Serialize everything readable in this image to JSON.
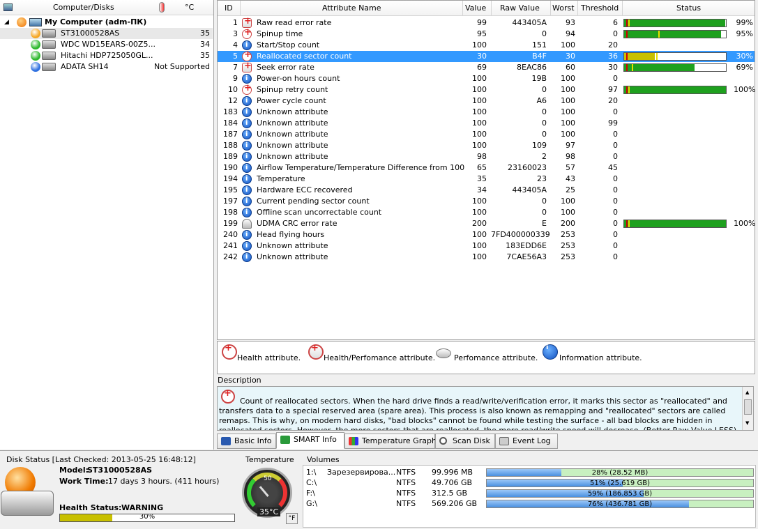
{
  "tree": {
    "header_name": "Computer/Disks",
    "header_temp": "°C",
    "root": "My Computer (adm-ПК)",
    "disks": [
      {
        "name": "ST31000528AS",
        "temp": "35",
        "color": "#f5a623"
      },
      {
        "name": "WDC WD15EARS-00Z5...",
        "temp": "34",
        "color": "#2db82d"
      },
      {
        "name": "Hitachi HDP725050GL...",
        "temp": "35",
        "color": "#2db82d"
      },
      {
        "name": "ADATA SH14",
        "temp": "Not Supported",
        "color": "#2d6fe0"
      }
    ]
  },
  "table": {
    "headers": [
      "ID",
      "Attribute Name",
      "Value",
      "Raw Value",
      "Worst",
      "Threshold",
      "Status"
    ],
    "rows": [
      {
        "id": "1",
        "icon": "health-perf",
        "name": "Raw read error rate",
        "value": "99",
        "raw": "443405A",
        "worst": "93",
        "thr": "6",
        "pct": "99%",
        "level": 0.99
      },
      {
        "id": "3",
        "icon": "health",
        "name": "Spinup time",
        "value": "95",
        "raw": "0",
        "worst": "94",
        "thr": "0",
        "pct": "95%",
        "level": 0.95
      },
      {
        "id": "4",
        "icon": "info",
        "name": "Start/Stop count",
        "value": "100",
        "raw": "151",
        "worst": "100",
        "thr": "20",
        "pct": "",
        "level": 0
      },
      {
        "id": "5",
        "icon": "health",
        "name": "Reallocated sector count",
        "value": "30",
        "raw": "B4F",
        "worst": "30",
        "thr": "36",
        "pct": "30%",
        "level": 0.3
      },
      {
        "id": "7",
        "icon": "health-perf",
        "name": "Seek error rate",
        "value": "69",
        "raw": "8EAC86",
        "worst": "60",
        "thr": "30",
        "pct": "69%",
        "level": 0.69
      },
      {
        "id": "9",
        "icon": "info",
        "name": "Power-on hours count",
        "value": "100",
        "raw": "19B",
        "worst": "100",
        "thr": "0",
        "pct": "",
        "level": 0
      },
      {
        "id": "10",
        "icon": "health",
        "name": "Spinup retry count",
        "value": "100",
        "raw": "0",
        "worst": "100",
        "thr": "97",
        "pct": "100%",
        "level": 1.0
      },
      {
        "id": "12",
        "icon": "info",
        "name": "Power cycle count",
        "value": "100",
        "raw": "A6",
        "worst": "100",
        "thr": "20",
        "pct": "",
        "level": 0
      },
      {
        "id": "183",
        "icon": "info",
        "name": "Unknown attribute",
        "value": "100",
        "raw": "0",
        "worst": "100",
        "thr": "0",
        "pct": "",
        "level": 0
      },
      {
        "id": "184",
        "icon": "info",
        "name": "Unknown attribute",
        "value": "100",
        "raw": "0",
        "worst": "100",
        "thr": "99",
        "pct": "",
        "level": 0
      },
      {
        "id": "187",
        "icon": "info",
        "name": "Unknown attribute",
        "value": "100",
        "raw": "0",
        "worst": "100",
        "thr": "0",
        "pct": "",
        "level": 0
      },
      {
        "id": "188",
        "icon": "info",
        "name": "Unknown attribute",
        "value": "100",
        "raw": "109",
        "worst": "97",
        "thr": "0",
        "pct": "",
        "level": 0
      },
      {
        "id": "189",
        "icon": "info",
        "name": "Unknown attribute",
        "value": "98",
        "raw": "2",
        "worst": "98",
        "thr": "0",
        "pct": "",
        "level": 0
      },
      {
        "id": "190",
        "icon": "info",
        "name": "Airflow Temperature/Temperature Difference from 100",
        "value": "65",
        "raw": "23160023",
        "worst": "57",
        "thr": "45",
        "pct": "",
        "level": 0
      },
      {
        "id": "194",
        "icon": "info",
        "name": "Temperature",
        "value": "35",
        "raw": "23",
        "worst": "43",
        "thr": "0",
        "pct": "",
        "level": 0
      },
      {
        "id": "195",
        "icon": "info",
        "name": "Hardware ECC recovered",
        "value": "34",
        "raw": "443405A",
        "worst": "25",
        "thr": "0",
        "pct": "",
        "level": 0
      },
      {
        "id": "197",
        "icon": "info",
        "name": "Current pending sector count",
        "value": "100",
        "raw": "0",
        "worst": "100",
        "thr": "0",
        "pct": "",
        "level": 0
      },
      {
        "id": "198",
        "icon": "info",
        "name": "Offline scan uncorrectable count",
        "value": "100",
        "raw": "0",
        "worst": "100",
        "thr": "0",
        "pct": "",
        "level": 0
      },
      {
        "id": "199",
        "icon": "perf",
        "name": "UDMA CRC error rate",
        "value": "200",
        "raw": "E",
        "worst": "200",
        "thr": "0",
        "pct": "100%",
        "level": 1.0
      },
      {
        "id": "240",
        "icon": "info",
        "name": "Head flying hours",
        "value": "100",
        "raw": "7FD400000339",
        "worst": "253",
        "thr": "0",
        "pct": "",
        "level": 0
      },
      {
        "id": "241",
        "icon": "info",
        "name": "Unknown attribute",
        "value": "100",
        "raw": "183EDD6E",
        "worst": "253",
        "thr": "0",
        "pct": "",
        "level": 0
      },
      {
        "id": "242",
        "icon": "info",
        "name": "Unknown attribute",
        "value": "100",
        "raw": "7CAE56A3",
        "worst": "253",
        "thr": "0",
        "pct": "",
        "level": 0
      }
    ],
    "bar_green": "#1ea01e",
    "bar_warn": "#c8c000"
  },
  "legend": {
    "health": "Health attribute.",
    "health_perf": "Health/Perfomance attribute.",
    "perf": "Perfomance attribute.",
    "info": "Information attribute."
  },
  "description": {
    "label": "Description",
    "text": "Count of reallocated sectors. When the hard drive finds a read/write/verification error, it marks this sector as \"reallocated\" and transfers data to a special reserved area (spare area). This process is also known as remapping and \"reallocated\" sectors are called remaps. This is why, on modern hard disks, \"bad blocks\" cannot be found while testing the surface - all bad blocks are hidden in reallocated sectors. However, the more sectors that are reallocated, the more read/write speed will decrease. (Better Raw Value LESS)"
  },
  "tabs": [
    "Basic Info",
    "SMART Info",
    "Temperature Graph",
    "Scan Disk",
    "Event Log"
  ],
  "status": {
    "title": "Disk Status [Last Checked: 2013-05-25 16:48:12]",
    "model_label": "Model:",
    "model": "ST31000528AS",
    "work_label": "Work Time:",
    "work": "17 days 3 hours. (411 hours)",
    "health_label": "Health Status:",
    "health": "WARNING",
    "health_pct": "30%",
    "health_level": 0.3
  },
  "temperature": {
    "title": "Temperature",
    "value": "35°C",
    "dial_label": "50",
    "unit_button": "°F"
  },
  "volumes": {
    "title": "Volumes",
    "rows": [
      {
        "drive": "1:\\",
        "label": "Зарезервирова...",
        "fs": "NTFS",
        "size": "99.996 MB",
        "usage": "28% (28.52 MB)",
        "level": 0.28
      },
      {
        "drive": "C:\\",
        "label": "",
        "fs": "NTFS",
        "size": "49.706 GB",
        "usage": "51% (25.619 GB)",
        "level": 0.51
      },
      {
        "drive": "F:\\",
        "label": "",
        "fs": "NTFS",
        "size": "312.5 GB",
        "usage": "59% (186.853 GB)",
        "level": 0.59
      },
      {
        "drive": "G:\\",
        "label": "",
        "fs": "NTFS",
        "size": "569.206 GB",
        "usage": "76% (436.781 GB)",
        "level": 0.76
      }
    ]
  }
}
